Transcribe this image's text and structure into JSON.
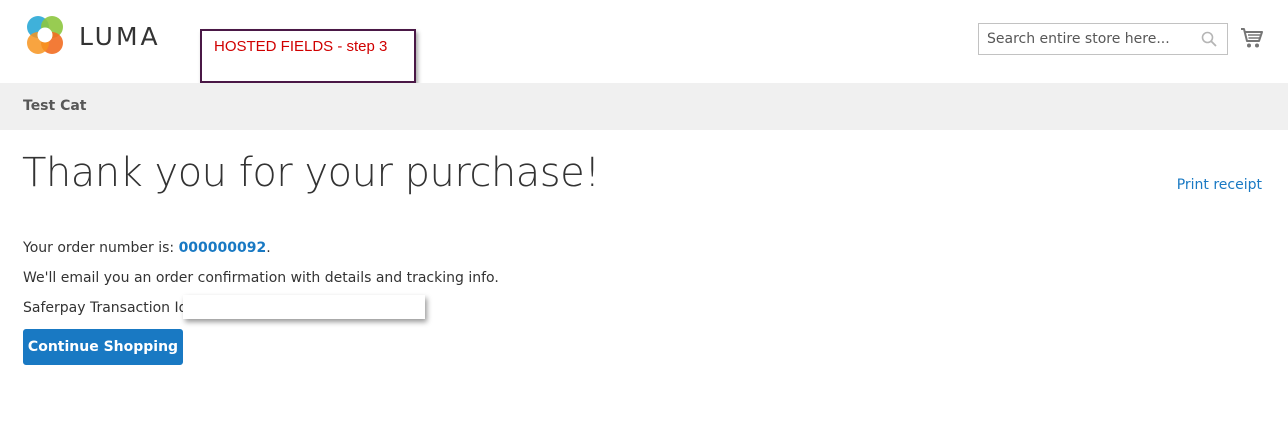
{
  "header": {
    "logo_text": "LUMA",
    "search_placeholder": "Search entire store here...",
    "annotation_label": "HOSTED FIELDS - step 3",
    "icons": [
      "luma-logo-icon",
      "search-icon",
      "cart-icon"
    ]
  },
  "nav": {
    "category": "Test Cat"
  },
  "main": {
    "title": "Thank you for your purchase!",
    "print_receipt": "Print receipt",
    "order_prefix": "Your order number is: ",
    "order_number": "000000092",
    "order_suffix": ".",
    "email_note": "We'll email you an order confirmation with details and tracking info.",
    "transaction_label": "Saferpay Transaction Id:",
    "continue_button": "Continue Shopping"
  },
  "colors": {
    "accent": "#1979c3",
    "annotation_text": "#d00000",
    "annotation_border": "#4a1846",
    "nav_background": "#f0f0f0"
  }
}
